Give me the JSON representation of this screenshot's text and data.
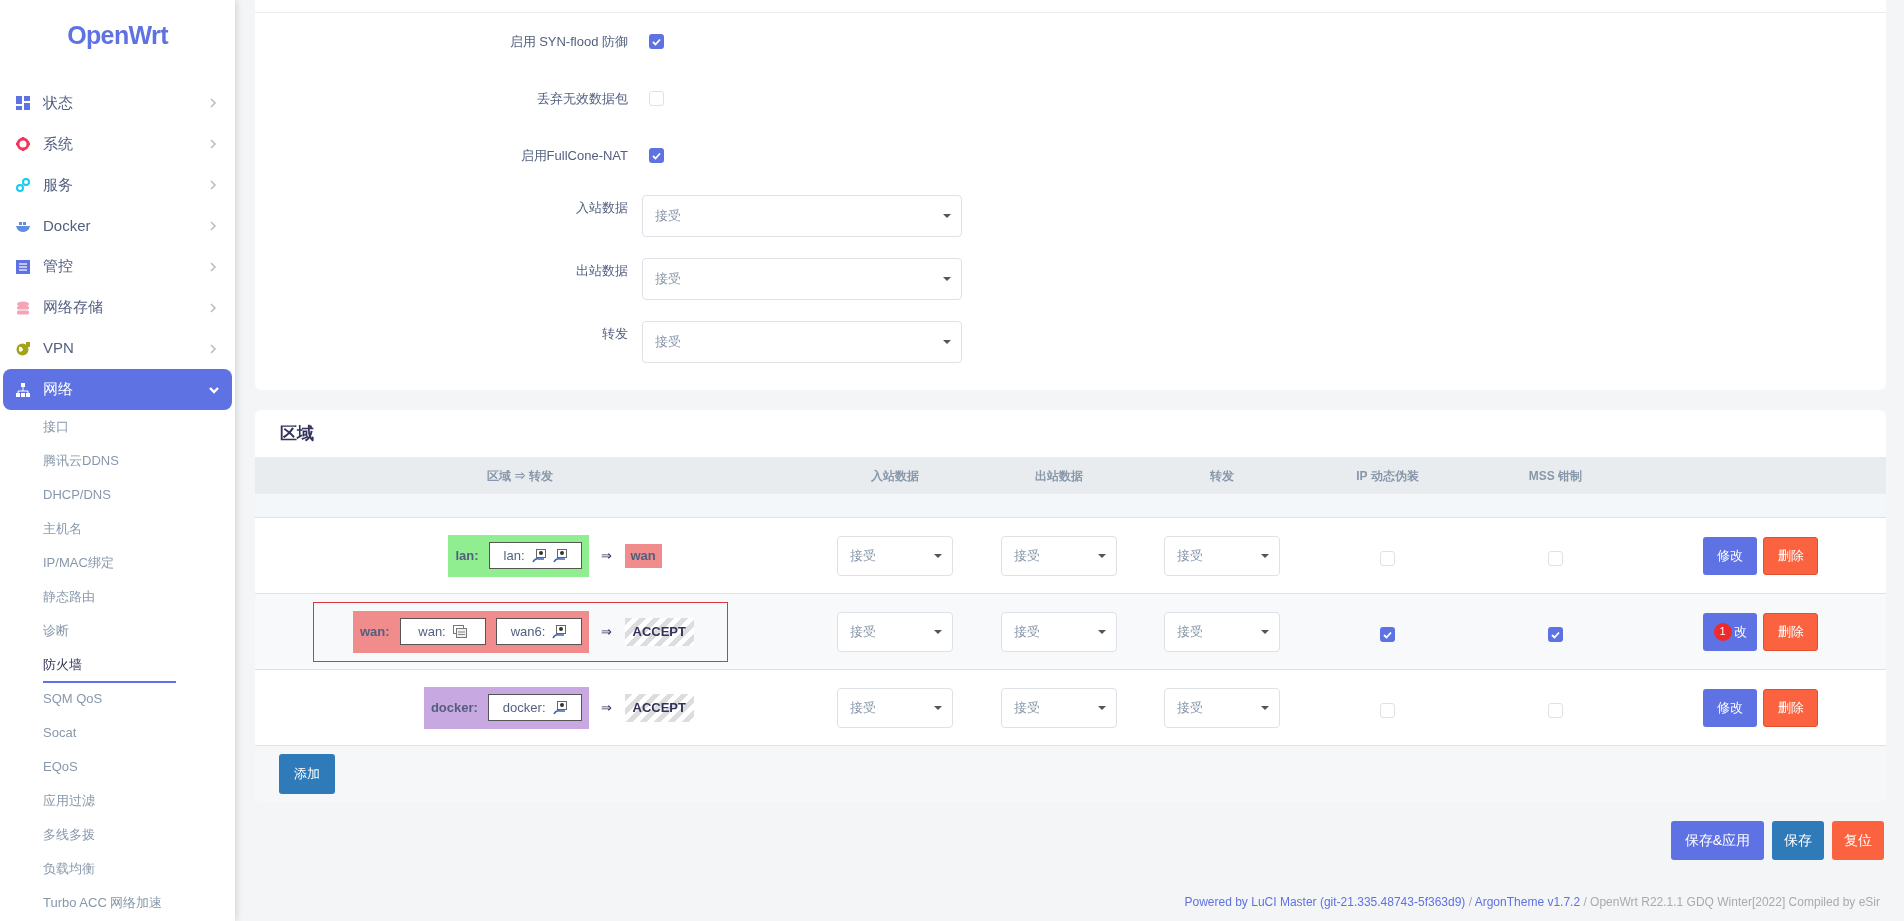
{
  "sidebar": {
    "logo": "OpenWrt",
    "items": [
      {
        "label": "状态",
        "expanded": false
      },
      {
        "label": "系统",
        "expanded": false
      },
      {
        "label": "服务",
        "expanded": false
      },
      {
        "label": "Docker",
        "expanded": false
      },
      {
        "label": "管控",
        "expanded": false
      },
      {
        "label": "网络存储",
        "expanded": false
      },
      {
        "label": "VPN",
        "expanded": false
      },
      {
        "label": "网络",
        "expanded": true,
        "children": [
          {
            "label": "接口",
            "selected": false
          },
          {
            "label": "腾讯云DDNS",
            "selected": false
          },
          {
            "label": "DHCP/DNS",
            "selected": false
          },
          {
            "label": "主机名",
            "selected": false
          },
          {
            "label": "IP/MAC绑定",
            "selected": false
          },
          {
            "label": "静态路由",
            "selected": false
          },
          {
            "label": "诊断",
            "selected": false
          },
          {
            "label": "防火墙",
            "selected": true
          },
          {
            "label": "SQM QoS",
            "selected": false
          },
          {
            "label": "Socat",
            "selected": false
          },
          {
            "label": "EQoS",
            "selected": false
          },
          {
            "label": "应用过滤",
            "selected": false
          },
          {
            "label": "多线多拨",
            "selected": false
          },
          {
            "label": "负载均衡",
            "selected": false
          },
          {
            "label": "Turbo ACC 网络加速",
            "selected": false
          }
        ]
      }
    ]
  },
  "settings": [
    {
      "kind": "checkbox",
      "label": "启用 SYN-flood 防御",
      "checked": true
    },
    {
      "kind": "checkbox",
      "label": "丢弃无效数据包",
      "checked": false
    },
    {
      "kind": "checkbox",
      "label": "启用FullCone-NAT",
      "checked": true
    },
    {
      "kind": "select",
      "label": "入站数据",
      "value": "接受"
    },
    {
      "kind": "select",
      "label": "出站数据",
      "value": "接受"
    },
    {
      "kind": "select",
      "label": "转发",
      "value": "接受"
    }
  ],
  "zones": {
    "title": "区域",
    "columns": [
      "区域 ⇒ 转发",
      "入站数据",
      "出站数据",
      "转发",
      "IP 动态伪装",
      "MSS 钳制"
    ],
    "rows": [
      {
        "outlined": false,
        "zone": {
          "name": "lan:",
          "color": "#90ee90"
        },
        "networks": [
          {
            "label": "lan:",
            "devices": [
              {
                "kind": "ethernet"
              },
              {
                "kind": "ethernet"
              }
            ]
          }
        ],
        "arrow": "⇒",
        "target": {
          "kind": "zone",
          "label": "wan",
          "color": "#f08c8c"
        },
        "input": "接受",
        "output": "接受",
        "forward": "接受",
        "masq": false,
        "mss": false,
        "edit": {
          "label": "修改"
        },
        "delete": "删除"
      },
      {
        "outlined": true,
        "zone": {
          "name": "wan:",
          "color": "#f08c8c"
        },
        "networks": [
          {
            "label": "wan:",
            "devices": [
              {
                "kind": "virtual"
              }
            ]
          },
          {
            "label": "wan6:",
            "devices": [
              {
                "kind": "ethernet"
              }
            ]
          }
        ],
        "arrow": "⇒",
        "target": {
          "kind": "policy",
          "label": "ACCEPT"
        },
        "input": "接受",
        "output": "接受",
        "forward": "接受",
        "masq": true,
        "mss": true,
        "edit": {
          "label": "改",
          "badge": "1"
        },
        "delete": "删除"
      },
      {
        "outlined": false,
        "zone": {
          "name": "docker:",
          "color": "#c8a8e0"
        },
        "networks": [
          {
            "label": "docker:",
            "devices": [
              {
                "kind": "ethernet"
              }
            ]
          }
        ],
        "arrow": "⇒",
        "target": {
          "kind": "policy",
          "label": "ACCEPT"
        },
        "input": "接受",
        "output": "接受",
        "forward": "接受",
        "masq": false,
        "mss": false,
        "edit": {
          "label": "修改"
        },
        "delete": "删除"
      }
    ],
    "add_button": "添加"
  },
  "buttons": [
    {
      "kind": "primary",
      "label": "保存&应用"
    },
    {
      "kind": "info",
      "label": "保存"
    },
    {
      "kind": "danger",
      "label": "复位"
    }
  ],
  "footer": [
    {
      "kind": "link",
      "text": "Powered by LuCI Master (git-21.335.48743-5f363d9)"
    },
    {
      "kind": "text",
      "text": " / "
    },
    {
      "kind": "link",
      "text": "ArgonTheme v1.7.2"
    },
    {
      "kind": "text",
      "text": " / OpenWrt R22.1.1 GDQ Winter[2022] Compiled by eSir"
    }
  ]
}
